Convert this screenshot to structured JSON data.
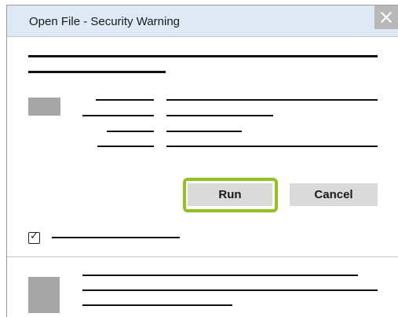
{
  "dialog": {
    "title": "Open File - Security Warning",
    "close_icon": "close-icon"
  },
  "buttons": {
    "run_label": "Run",
    "cancel_label": "Cancel",
    "highlight_color": "#95c11f"
  },
  "checkbox": {
    "checked": true
  },
  "icons": {
    "file_icon": "file-icon",
    "shield_icon": "shield-icon"
  }
}
